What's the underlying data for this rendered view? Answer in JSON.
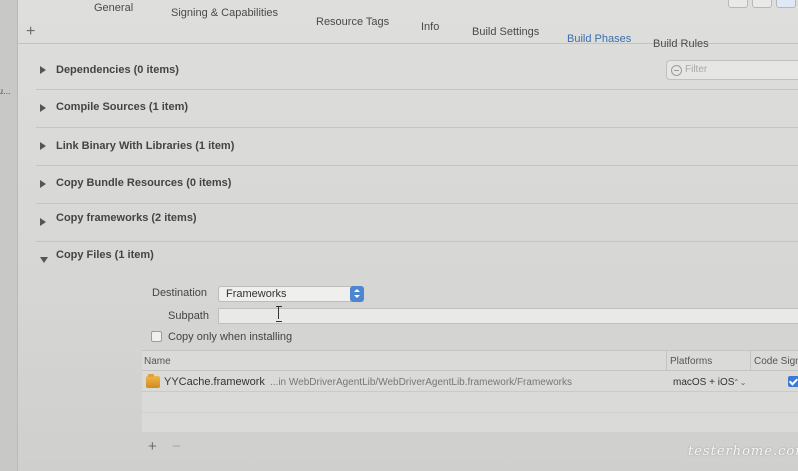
{
  "navigator": {
    "item_label": "u..."
  },
  "tabs": [
    {
      "label": "General"
    },
    {
      "label": "Signing & Capabilities"
    },
    {
      "label": "Resource Tags"
    },
    {
      "label": "Info"
    },
    {
      "label": "Build Settings"
    },
    {
      "label": "Build Phases"
    },
    {
      "label": "Build Rules"
    }
  ],
  "active_tab": "Build Phases",
  "toolbar": {
    "add_label": "+"
  },
  "filter": {
    "placeholder": "Filter"
  },
  "phases": [
    {
      "title": "Dependencies (0 items)",
      "expanded": false
    },
    {
      "title": "Compile Sources (1 item)",
      "expanded": false
    },
    {
      "title": "Link Binary With Libraries (1 item)",
      "expanded": false
    },
    {
      "title": "Copy Bundle Resources (0 items)",
      "expanded": false
    },
    {
      "title": "Copy frameworks (2 items)",
      "expanded": false
    },
    {
      "title": "Copy Files (1 item)",
      "expanded": true
    }
  ],
  "copy_files": {
    "destination_label": "Destination",
    "destination_value": "Frameworks",
    "subpath_label": "Subpath",
    "subpath_value": "",
    "copy_only_label": "Copy only when installing",
    "copy_only_checked": false,
    "table": {
      "headers": {
        "name": "Name",
        "platforms": "Platforms",
        "code_sign": "Code Sign O"
      },
      "rows": [
        {
          "name": "YYCache.framework",
          "path": "...in WebDriverAgentLib/WebDriverAgentLib.framework/Frameworks",
          "platforms": "macOS + iOS",
          "code_sign": true
        }
      ]
    },
    "add_label": "+",
    "remove_label": "−"
  },
  "watermark": "testerhome.com",
  "colors": {
    "accent": "#3a6fb0",
    "checkbox_on": "#3b7bd4",
    "framework_icon": "#e0a238"
  }
}
